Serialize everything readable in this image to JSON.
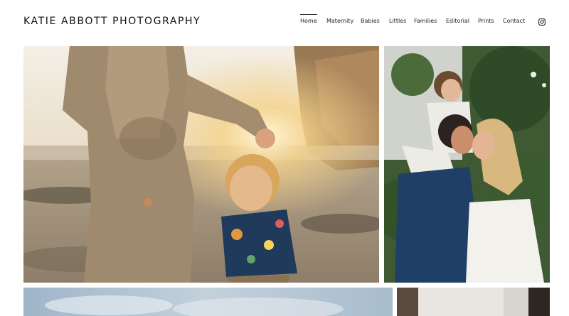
{
  "site": {
    "title": "KATIE ABBOTT PHOTOGRAPHY"
  },
  "nav": {
    "items": [
      {
        "label": "Home",
        "active": true
      },
      {
        "label": "Maternity",
        "active": false
      },
      {
        "label": "Babies",
        "active": false
      },
      {
        "label": "Littles",
        "active": false
      },
      {
        "label": "Families",
        "active": false
      },
      {
        "label": "Editorial",
        "active": false
      },
      {
        "label": "Prints",
        "active": false
      },
      {
        "label": "Contact",
        "active": false
      }
    ],
    "social_icon": "instagram-icon"
  },
  "gallery": {
    "photos": [
      {
        "name": "photo-maternity-beach",
        "subject": "pregnant mother and toddler on beach at sunset"
      },
      {
        "name": "photo-family-garden",
        "subject": "family kissing with child on shoulders in front of ivy wall"
      },
      {
        "name": "photo-sky-landscape",
        "subject": "sky with clouds"
      },
      {
        "name": "photo-interior",
        "subject": "interior doorway"
      }
    ]
  },
  "colors": {
    "text": "#111111",
    "background": "#ffffff"
  }
}
